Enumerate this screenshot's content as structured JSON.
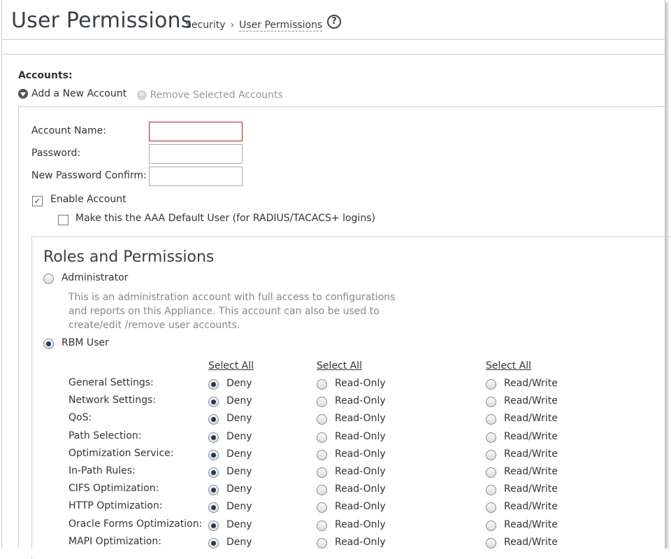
{
  "header": {
    "title": "User Permissions",
    "breadcrumb": [
      "Security",
      "User Permissions"
    ],
    "help_glyph": "?"
  },
  "accounts": {
    "label": "Accounts:",
    "add_label": "Add a New Account",
    "remove_label": "Remove Selected Accounts"
  },
  "form": {
    "account_name_label": "Account Name:",
    "account_name_value": "",
    "password_label": "Password:",
    "password_value": "",
    "confirm_label": "New Password Confirm:",
    "confirm_value": "",
    "enable_account_label": "Enable Account",
    "enable_account_checked": true,
    "aaa_default_label": "Make this the AAA Default User (for RADIUS/TACACS+ logins)",
    "aaa_default_checked": false
  },
  "roles": {
    "title": "Roles and Permissions",
    "administrator_label": "Administrator",
    "administrator_selected": false,
    "administrator_desc": "This is an administration account with full access to configurations and reports on this Appliance. This account can also be used to create/edit /remove user accounts.",
    "rbm_label": "RBM User",
    "rbm_selected": true,
    "select_all": [
      "Select All",
      "Select All",
      "Select All"
    ],
    "options": [
      "Deny",
      "Read-Only",
      "Read/Write"
    ],
    "permissions": [
      {
        "name": "General Settings:",
        "selected": "Deny"
      },
      {
        "name": "Network Settings:",
        "selected": "Deny"
      },
      {
        "name": "QoS:",
        "selected": "Deny"
      },
      {
        "name": "Path Selection:",
        "selected": "Deny"
      },
      {
        "name": "Optimization Service:",
        "selected": "Deny"
      },
      {
        "name": "In-Path Rules:",
        "selected": "Deny"
      },
      {
        "name": "CIFS Optimization:",
        "selected": "Deny"
      },
      {
        "name": "HTTP Optimization:",
        "selected": "Deny"
      },
      {
        "name": "Oracle Forms Optimization:",
        "selected": "Deny"
      },
      {
        "name": "MAPI Optimization:",
        "selected": "Deny"
      }
    ]
  },
  "colors": {
    "radio_selected": "#1d3b5c",
    "invalid_border": "#b22222",
    "title_text": "#3a3f44"
  }
}
